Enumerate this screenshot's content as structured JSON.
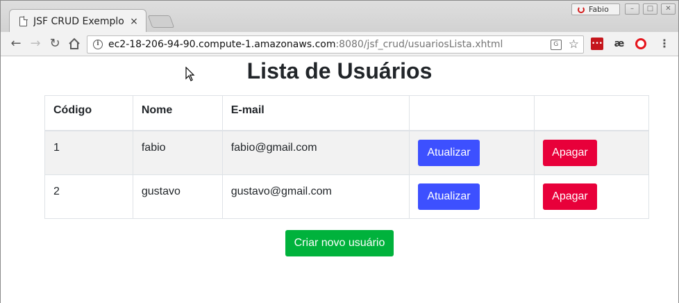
{
  "browser": {
    "tab_title": "JSF CRUD Exemplo",
    "tab_close": "×",
    "profile_name": "Fabio",
    "url_host": "ec2-18-206-94-90.compute-1.amazonaws.com",
    "url_path": ":8080/jsf_crud/usuariosLista.xhtml",
    "ext_ae": "æ",
    "menu": "⋮"
  },
  "page": {
    "title": "Lista de Usuários"
  },
  "table": {
    "headers": [
      "Código",
      "Nome",
      "E-mail",
      "",
      ""
    ],
    "rows": [
      {
        "code": "1",
        "name": "fabio",
        "email": "fabio@gmail.com",
        "update_label": "Atualizar",
        "delete_label": "Apagar"
      },
      {
        "code": "2",
        "name": "gustavo",
        "email": "gustavo@gmail.com",
        "update_label": "Atualizar",
        "delete_label": "Apagar"
      }
    ]
  },
  "actions": {
    "create_label": "Criar novo usuário"
  },
  "colors": {
    "update_button": "#3d50ff",
    "delete_button": "#e8003a",
    "create_button": "#00b23c",
    "striped_row": "#f2f2f2"
  }
}
